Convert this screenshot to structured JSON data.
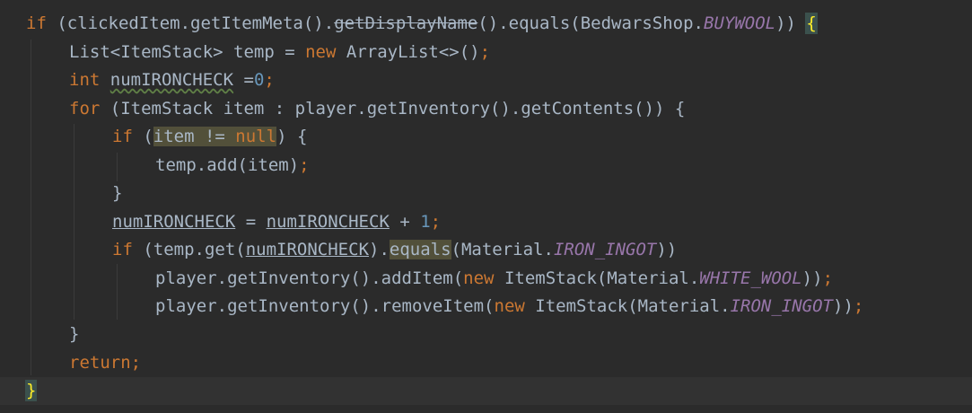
{
  "editor": {
    "colors": {
      "background": "#2b2b2b",
      "current_line": "#323232",
      "keyword": "#cc7832",
      "number": "#6897bb",
      "static_field": "#9876aa",
      "text": "#a9b7c6",
      "brace_match": "#ffef28"
    },
    "lines": {
      "l1": {
        "if_kw": "if",
        "pre": " (clickedItem.getItemMeta().",
        "deprecated_call": "getDisplayName",
        "mid": "().equals(BedwarsShop.",
        "field": "BUYWOOL",
        "post": ")) ",
        "brace": "{"
      },
      "l2": {
        "pre": "List<ItemStack> temp = ",
        "new_kw": "new",
        "post": " ArrayList<>()",
        "semi": ";"
      },
      "l3": {
        "int_kw": "int",
        "space": " ",
        "var": "numIRONCHECK",
        "eq": " =",
        "num": "0",
        "semi": ";"
      },
      "l4": {
        "for_kw": "for",
        "post": " (ItemStack item : player.getInventory().getContents()) {"
      },
      "l5": {
        "if_kw": "if",
        "open": " (",
        "cond": "item != ",
        "null_kw": "null",
        "post": ") {"
      },
      "l6": {
        "pre": "temp.add(item)",
        "semi": ";"
      },
      "l7": {
        "brace": "}"
      },
      "l8": {
        "var1": "numIRONCHECK",
        "mid": " = ",
        "var2": "numIRONCHECK",
        "plus": " + ",
        "num": "1",
        "semi": ";"
      },
      "l9": {
        "if_kw": "if",
        "pre": " (temp.get(",
        "var": "numIRONCHECK",
        "dot": ").",
        "equals": "equals",
        "mid": "(Material.",
        "field": "IRON_INGOT",
        "post": "))"
      },
      "l10": {
        "pre": "player.getInventory().addItem(",
        "new_kw": "new",
        "mid": " ItemStack(Material.",
        "field": "WHITE_WOOL",
        "post": "))",
        "semi": ";"
      },
      "l11": {
        "pre": "player.getInventory().removeItem(",
        "new_kw": "new",
        "mid": " ItemStack(Material.",
        "field": "IRON_INGOT",
        "post": "))",
        "semi": ";"
      },
      "l12": {
        "brace": "}"
      },
      "l13": {
        "return_kw": "return",
        "semi": ";"
      },
      "l14": {
        "brace": "}"
      }
    }
  }
}
